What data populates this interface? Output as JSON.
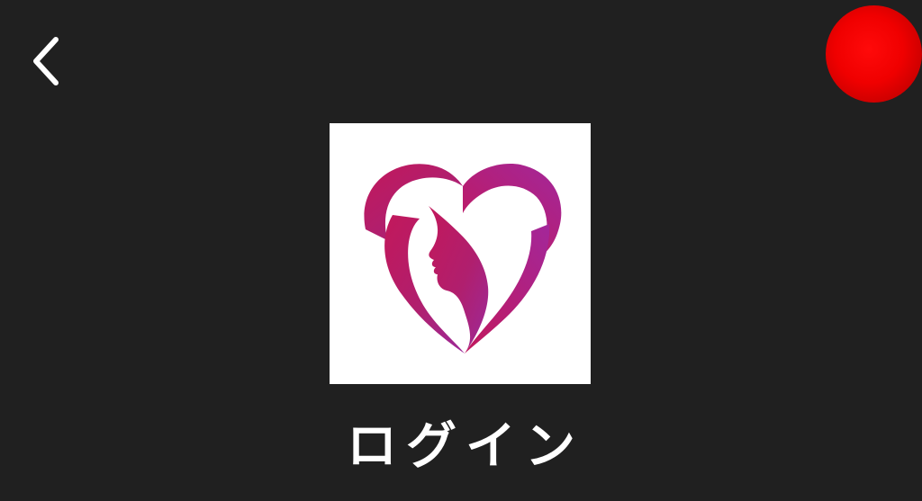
{
  "header": {
    "back_icon": "chevron-left-icon",
    "record_icon": "red-circle-icon"
  },
  "logo": {
    "description_icon": "heart-woman-silhouette-logo",
    "gradient_start": "#c2185b",
    "gradient_end": "#9c2a9a",
    "background": "#ffffff"
  },
  "page": {
    "title": "ログイン"
  },
  "colors": {
    "background": "#202020",
    "record": "#f00000",
    "text": "#ffffff"
  }
}
